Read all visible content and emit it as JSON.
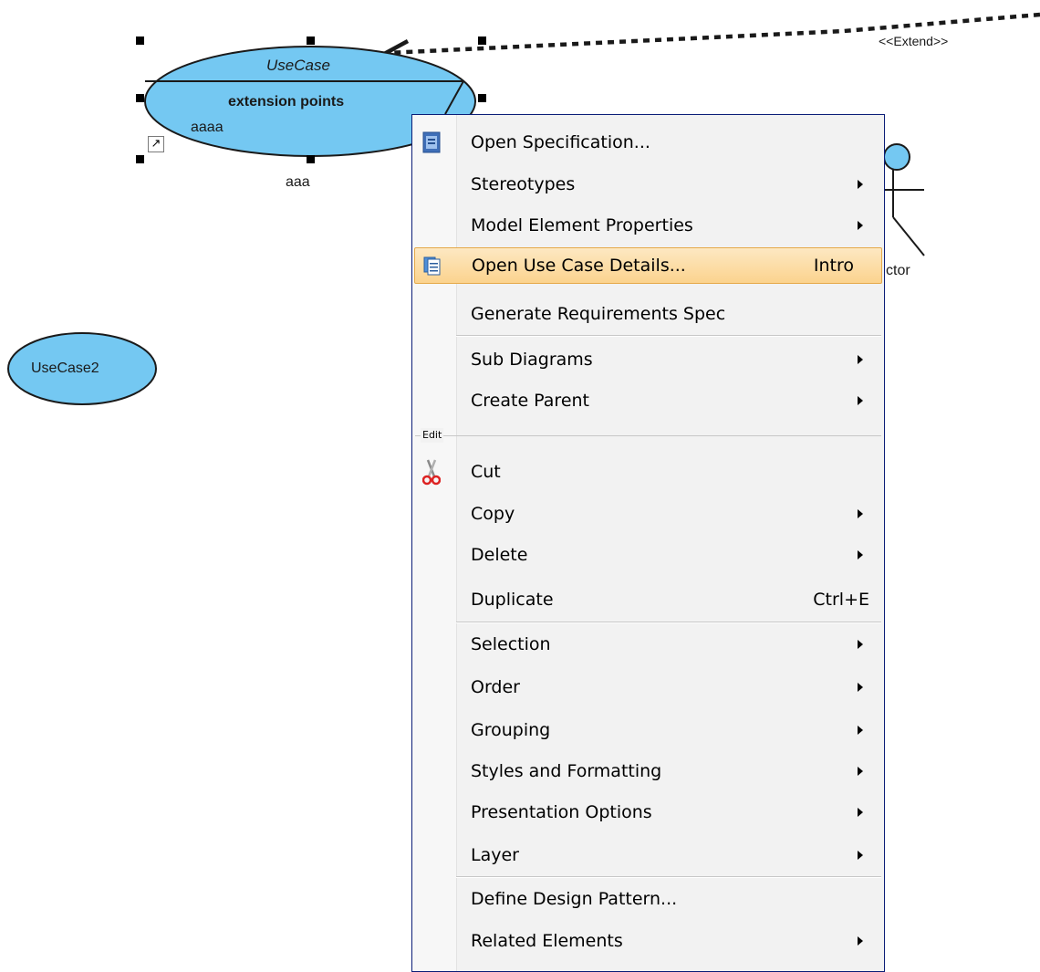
{
  "diagram": {
    "use_case": {
      "name": "UseCase",
      "extension_points_title": "extension points",
      "extension_point": "aaaa",
      "label_below": "aaa"
    },
    "use_case_2": {
      "name": "UseCase2"
    },
    "extend_relationship": {
      "stereotype": "<<Extend>>"
    },
    "actor": {
      "name_visible": "ctor"
    },
    "colors": {
      "use_case_fill": "#74c8f2",
      "line": "#1a1a1a",
      "menu_border": "#0b1d77",
      "menu_highlight": "#fbd38e"
    }
  },
  "context_menu": {
    "items": [
      {
        "label": "Open Specification...",
        "icon": "open-specification-icon",
        "submenu": false
      },
      {
        "label": "Stereotypes",
        "submenu": true
      },
      {
        "label": "Model Element Properties",
        "submenu": true
      },
      {
        "label": "Open Use Case Details...",
        "icon": "use-case-details-icon",
        "shortcut": "Intro",
        "highlighted": true
      },
      {
        "label": "Generate Requirements Spec",
        "submenu": false
      },
      {
        "label": "Sub Diagrams",
        "submenu": true
      },
      {
        "label": "Create Parent",
        "submenu": true
      },
      {
        "label": "Cut",
        "icon": "scissors-icon",
        "submenu": false
      },
      {
        "label": "Copy",
        "submenu": true
      },
      {
        "label": "Delete",
        "submenu": true
      },
      {
        "label": "Duplicate",
        "shortcut": "Ctrl+E"
      },
      {
        "label": "Selection",
        "submenu": true
      },
      {
        "label": "Order",
        "submenu": true
      },
      {
        "label": "Grouping",
        "submenu": true
      },
      {
        "label": "Styles and Formatting",
        "submenu": true
      },
      {
        "label": "Presentation Options",
        "submenu": true
      },
      {
        "label": "Layer",
        "submenu": true
      },
      {
        "label": "Define Design Pattern...",
        "submenu": false
      },
      {
        "label": "Related Elements",
        "submenu": true
      }
    ],
    "group_label": "Edit"
  }
}
